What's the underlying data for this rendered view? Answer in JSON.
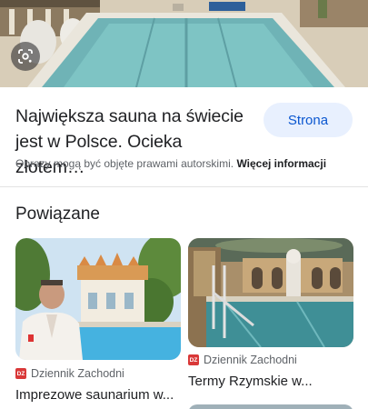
{
  "hero": {
    "lens_icon": "google-lens-icon"
  },
  "result": {
    "title": "Największa sauna na świecie jest w Polsce. Ocieka złotem…",
    "visit_label": "Strona",
    "copyright_text": "Obrazy mogą być objęte prawami autorskimi.",
    "more_info_label": "Więcej informacji"
  },
  "related": {
    "title": "Powiązane",
    "items": [
      {
        "source_icon": "DZ",
        "source": "Dziennik Zachodni",
        "title": "Imprezowe saunarium w..."
      },
      {
        "source_icon": "DZ",
        "source": "Dziennik Zachodni",
        "title": "Termy Rzymskie w..."
      }
    ]
  },
  "colors": {
    "accent": "#0b57d0",
    "accent_bg": "#e8f0fe",
    "favicon": "#d93838",
    "text": "#202124",
    "muted": "#5f6368"
  }
}
